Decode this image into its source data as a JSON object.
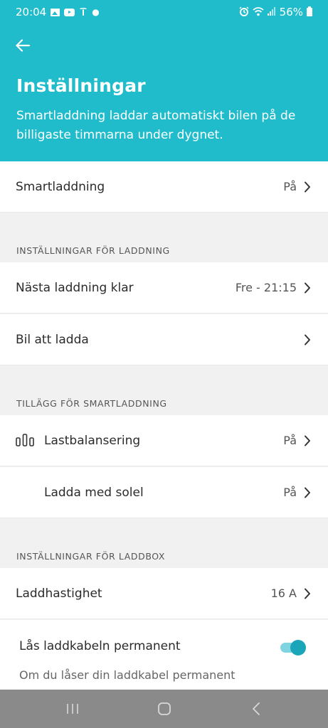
{
  "status_bar": {
    "time": "20:04",
    "battery": "56%",
    "icons_left": [
      "gallery-icon",
      "youtube-icon",
      "tesla-icon",
      "dot-icon"
    ],
    "icons_right": [
      "alarm-icon",
      "wifi-icon",
      "signal-icon",
      "battery-icon"
    ]
  },
  "header": {
    "back_icon": "arrow-left-icon",
    "title": "Inställningar",
    "description": "Smartladdning laddar automatiskt bilen på de billigaste timmarna under dygnet."
  },
  "smart_charging": {
    "label": "Smartladdning",
    "value": "På"
  },
  "charging_settings": {
    "header": "INSTÄLLNINGAR FÖR LADDNING",
    "next_charge": {
      "label": "Nästa laddning klar",
      "value": "Fre - 21:15"
    },
    "car_to_charge": {
      "label": "Bil att ladda",
      "value": ""
    }
  },
  "smart_addons": {
    "header": "TILLÄGG FÖR SMARTLADDNING",
    "load_balancing": {
      "label": "Lastbalansering",
      "value": "På",
      "icon": "bar-chart-icon"
    },
    "solar_charging": {
      "label": "Ladda med solel",
      "value": "På"
    }
  },
  "chargebox_settings": {
    "header": "INSTÄLLNINGAR FÖR LADDBOX",
    "charge_speed": {
      "label": "Laddhastighet",
      "value": "16 A"
    },
    "lock_cable": {
      "label": "Lås laddkabeln permanent",
      "enabled": true,
      "description": "Om du låser din laddkabel permanent"
    }
  },
  "colors": {
    "accent": "#20bccc",
    "toggle_on": "#1aa6b8",
    "nav_bar": "#8a8a8a"
  },
  "nav_bar": {
    "buttons": [
      "recent-apps-icon",
      "home-icon",
      "back-icon"
    ]
  }
}
